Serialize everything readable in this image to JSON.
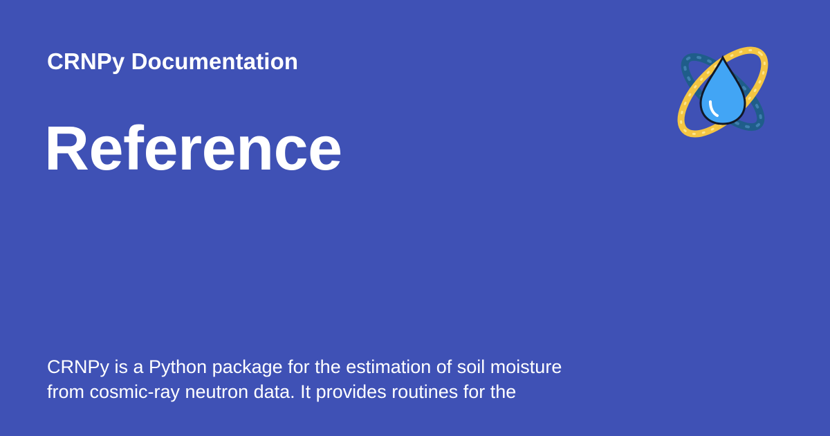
{
  "header": {
    "site_name": "CRNPy Documentation"
  },
  "page": {
    "title": "Reference",
    "description": "CRNPy is a Python package for the estimation of soil moisture\nfrom cosmic-ray neutron data. It provides routines for the"
  },
  "logo": {
    "icon": "water-drop-orbit-icon"
  },
  "colors": {
    "background": "#3f51b5",
    "text": "#ffffff",
    "orbit_gold": "#f4c542",
    "orbit_blue": "#1f5d8a",
    "drop_blue": "#42a5f5"
  }
}
